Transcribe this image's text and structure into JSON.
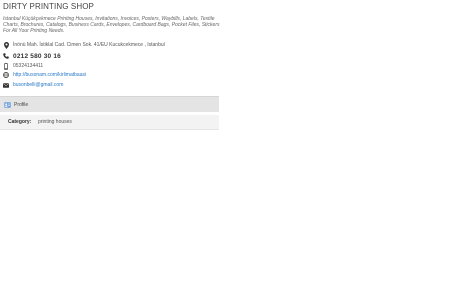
{
  "header": {
    "title": "DIRTY PRINTING SHOP",
    "description": "Istanbul Küçükçekmece Printing Houses, Invitations, Invoices, Posters, Waybills, Labels, Textile Charts, Brochures, Catalogs, Business Cards, Envelopes, Cardboard Bags, Pocket Files, Stickers For All Your Printing Needs."
  },
  "contact": {
    "address": "İnönü Mah. İstiklal Cad. Cimen Sok. 41/EU Kucukcekmece , Istanbul",
    "phone": "0212 580 30 16",
    "mobile": "05324134411",
    "website": "http://busonam.com/kirlimatbaasi",
    "email": "busonbelli@gmail.com"
  },
  "tabs": [
    {
      "label": "Profile",
      "icon": "profile-icon"
    }
  ],
  "details": {
    "category_label": "Category:",
    "category_value": "printing houses"
  },
  "colors": {
    "link": "#2a7ac7",
    "tab_bar": "#e4e4e4",
    "detail_row": "#f3f3f3"
  }
}
